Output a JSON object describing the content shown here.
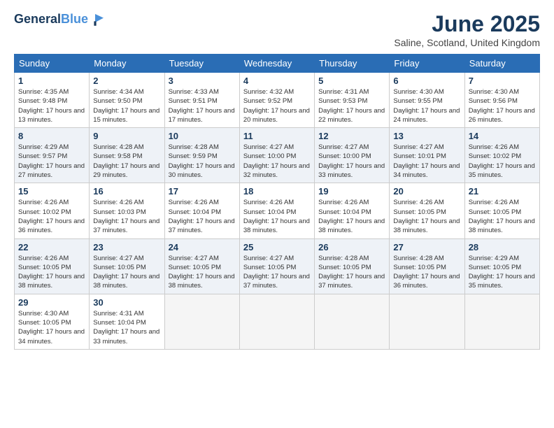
{
  "header": {
    "logo_line1": "General",
    "logo_line2": "Blue",
    "month_title": "June 2025",
    "location": "Saline, Scotland, United Kingdom"
  },
  "days_of_week": [
    "Sunday",
    "Monday",
    "Tuesday",
    "Wednesday",
    "Thursday",
    "Friday",
    "Saturday"
  ],
  "weeks": [
    [
      {
        "day": 1,
        "sunrise": "4:35 AM",
        "sunset": "9:48 PM",
        "daylight": "17 hours and 13 minutes."
      },
      {
        "day": 2,
        "sunrise": "4:34 AM",
        "sunset": "9:50 PM",
        "daylight": "17 hours and 15 minutes."
      },
      {
        "day": 3,
        "sunrise": "4:33 AM",
        "sunset": "9:51 PM",
        "daylight": "17 hours and 17 minutes."
      },
      {
        "day": 4,
        "sunrise": "4:32 AM",
        "sunset": "9:52 PM",
        "daylight": "17 hours and 20 minutes."
      },
      {
        "day": 5,
        "sunrise": "4:31 AM",
        "sunset": "9:53 PM",
        "daylight": "17 hours and 22 minutes."
      },
      {
        "day": 6,
        "sunrise": "4:30 AM",
        "sunset": "9:55 PM",
        "daylight": "17 hours and 24 minutes."
      },
      {
        "day": 7,
        "sunrise": "4:30 AM",
        "sunset": "9:56 PM",
        "daylight": "17 hours and 26 minutes."
      }
    ],
    [
      {
        "day": 8,
        "sunrise": "4:29 AM",
        "sunset": "9:57 PM",
        "daylight": "17 hours and 27 minutes."
      },
      {
        "day": 9,
        "sunrise": "4:28 AM",
        "sunset": "9:58 PM",
        "daylight": "17 hours and 29 minutes."
      },
      {
        "day": 10,
        "sunrise": "4:28 AM",
        "sunset": "9:59 PM",
        "daylight": "17 hours and 30 minutes."
      },
      {
        "day": 11,
        "sunrise": "4:27 AM",
        "sunset": "10:00 PM",
        "daylight": "17 hours and 32 minutes."
      },
      {
        "day": 12,
        "sunrise": "4:27 AM",
        "sunset": "10:00 PM",
        "daylight": "17 hours and 33 minutes."
      },
      {
        "day": 13,
        "sunrise": "4:27 AM",
        "sunset": "10:01 PM",
        "daylight": "17 hours and 34 minutes."
      },
      {
        "day": 14,
        "sunrise": "4:26 AM",
        "sunset": "10:02 PM",
        "daylight": "17 hours and 35 minutes."
      }
    ],
    [
      {
        "day": 15,
        "sunrise": "4:26 AM",
        "sunset": "10:02 PM",
        "daylight": "17 hours and 36 minutes."
      },
      {
        "day": 16,
        "sunrise": "4:26 AM",
        "sunset": "10:03 PM",
        "daylight": "17 hours and 37 minutes."
      },
      {
        "day": 17,
        "sunrise": "4:26 AM",
        "sunset": "10:04 PM",
        "daylight": "17 hours and 37 minutes."
      },
      {
        "day": 18,
        "sunrise": "4:26 AM",
        "sunset": "10:04 PM",
        "daylight": "17 hours and 38 minutes."
      },
      {
        "day": 19,
        "sunrise": "4:26 AM",
        "sunset": "10:04 PM",
        "daylight": "17 hours and 38 minutes."
      },
      {
        "day": 20,
        "sunrise": "4:26 AM",
        "sunset": "10:05 PM",
        "daylight": "17 hours and 38 minutes."
      },
      {
        "day": 21,
        "sunrise": "4:26 AM",
        "sunset": "10:05 PM",
        "daylight": "17 hours and 38 minutes."
      }
    ],
    [
      {
        "day": 22,
        "sunrise": "4:26 AM",
        "sunset": "10:05 PM",
        "daylight": "17 hours and 38 minutes."
      },
      {
        "day": 23,
        "sunrise": "4:27 AM",
        "sunset": "10:05 PM",
        "daylight": "17 hours and 38 minutes."
      },
      {
        "day": 24,
        "sunrise": "4:27 AM",
        "sunset": "10:05 PM",
        "daylight": "17 hours and 38 minutes."
      },
      {
        "day": 25,
        "sunrise": "4:27 AM",
        "sunset": "10:05 PM",
        "daylight": "17 hours and 37 minutes."
      },
      {
        "day": 26,
        "sunrise": "4:28 AM",
        "sunset": "10:05 PM",
        "daylight": "17 hours and 37 minutes."
      },
      {
        "day": 27,
        "sunrise": "4:28 AM",
        "sunset": "10:05 PM",
        "daylight": "17 hours and 36 minutes."
      },
      {
        "day": 28,
        "sunrise": "4:29 AM",
        "sunset": "10:05 PM",
        "daylight": "17 hours and 35 minutes."
      }
    ],
    [
      {
        "day": 29,
        "sunrise": "4:30 AM",
        "sunset": "10:05 PM",
        "daylight": "17 hours and 34 minutes."
      },
      {
        "day": 30,
        "sunrise": "4:31 AM",
        "sunset": "10:04 PM",
        "daylight": "17 hours and 33 minutes."
      },
      null,
      null,
      null,
      null,
      null
    ]
  ]
}
